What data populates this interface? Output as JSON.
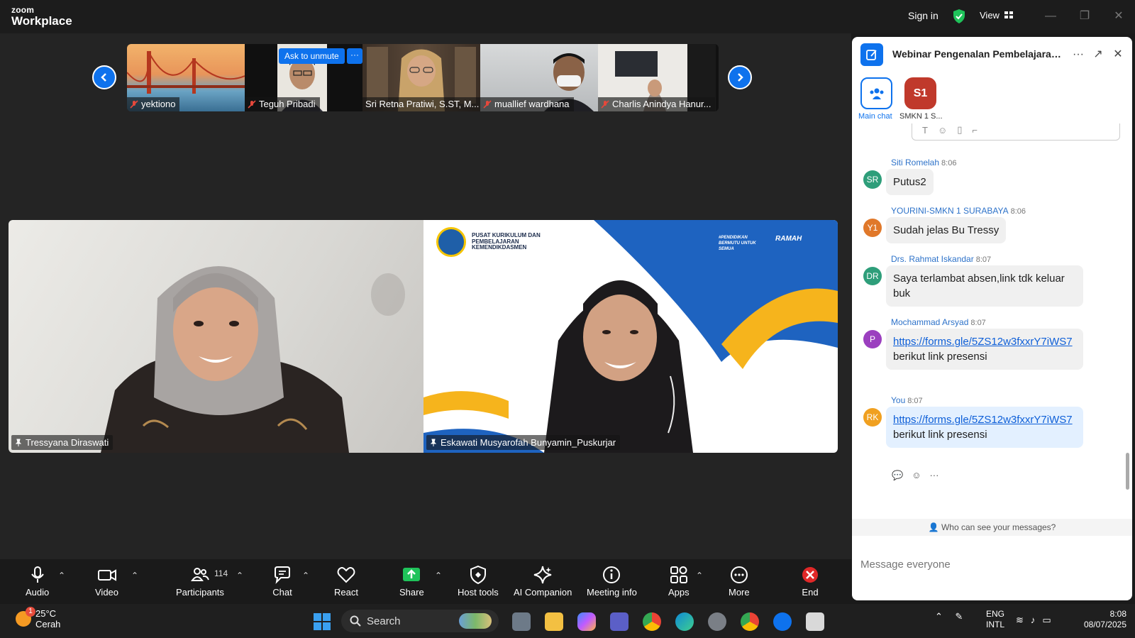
{
  "titlebar": {
    "logo_small": "zoom",
    "logo_big": "Workplace",
    "signin": "Sign in",
    "view": "View"
  },
  "thumbs": [
    {
      "name": "yektiono"
    },
    {
      "name": "Teguh Pribadi"
    },
    {
      "name": "Sri Retna Pratiwi, S.ST, M..."
    },
    {
      "name": "muallief wardhana"
    },
    {
      "name": "Charlis Anindya Hanur..."
    }
  ],
  "ask_unmute": "Ask to unmute",
  "thumb_more": "···",
  "videos": {
    "left_name": "Tressyana Diraswati",
    "right_name": "Eskawati Musyarofah Bunyamin_Puskurjar",
    "slide_org": [
      "PUSAT KURIKULUM DAN",
      "PEMBELAJARAN",
      "KEMENDIKDASMEN"
    ],
    "tag1": "#PENDIDIKAN BERMUTU UNTUK SEMUA",
    "tag2": "RAMAH"
  },
  "toolbar": {
    "audio": "Audio",
    "video": "Video",
    "participants": "Participants",
    "participants_count": "114",
    "chat": "Chat",
    "react": "React",
    "share": "Share",
    "host_tools": "Host tools",
    "ai_companion": "AI Companion",
    "meeting_info": "Meeting info",
    "apps": "Apps",
    "more": "More",
    "end": "End"
  },
  "chat": {
    "title": "Webinar Pengenalan Pembelajaran ...",
    "channels": [
      {
        "label": "Main chat",
        "badge": ""
      },
      {
        "label": "SMKN 1 S...",
        "badge": "S1"
      }
    ],
    "messages": [
      {
        "initials": "SR",
        "color": "#2e9e7a",
        "sender": "Siti Romelah",
        "time": "8:06",
        "text": "Putus2"
      },
      {
        "initials": "Y1",
        "color": "#e0782a",
        "sender": "YOURINI-SMKN 1 SURABAYA",
        "time": "8:06",
        "text": "Sudah jelas Bu Tressy"
      },
      {
        "initials": "DR",
        "color": "#2e9e7a",
        "sender": "Drs. Rahmat Iskandar",
        "time": "8:07",
        "text": "Saya terlambat absen,link tdk keluar buk"
      },
      {
        "initials": "P",
        "color": "#9b3fbf",
        "sender": "Mochammad Arsyad",
        "time": "8:07",
        "link": "https://forms.gle/5ZS12w3fxxrY7iWS7",
        "text": "berikut link presensi"
      },
      {
        "initials": "RK",
        "color": "#f0a020",
        "sender": "You",
        "time": "8:07",
        "link": "https://forms.gle/5ZS12w3fxxrY7iWS7",
        "text": "berikut link presensi"
      }
    ],
    "who_can_see": "Who can see your messages?",
    "placeholder": "Message everyone"
  },
  "taskbar": {
    "temp": "25°C",
    "weather": "Cerah",
    "weather_badge": "1",
    "search": "Search",
    "lang1": "ENG",
    "lang2": "INTL",
    "time": "8:08",
    "date": "08/07/2025"
  },
  "colors": {
    "zoom_blue": "#0e72ed",
    "end_red": "#e02828",
    "share_green": "#1fc35a"
  }
}
